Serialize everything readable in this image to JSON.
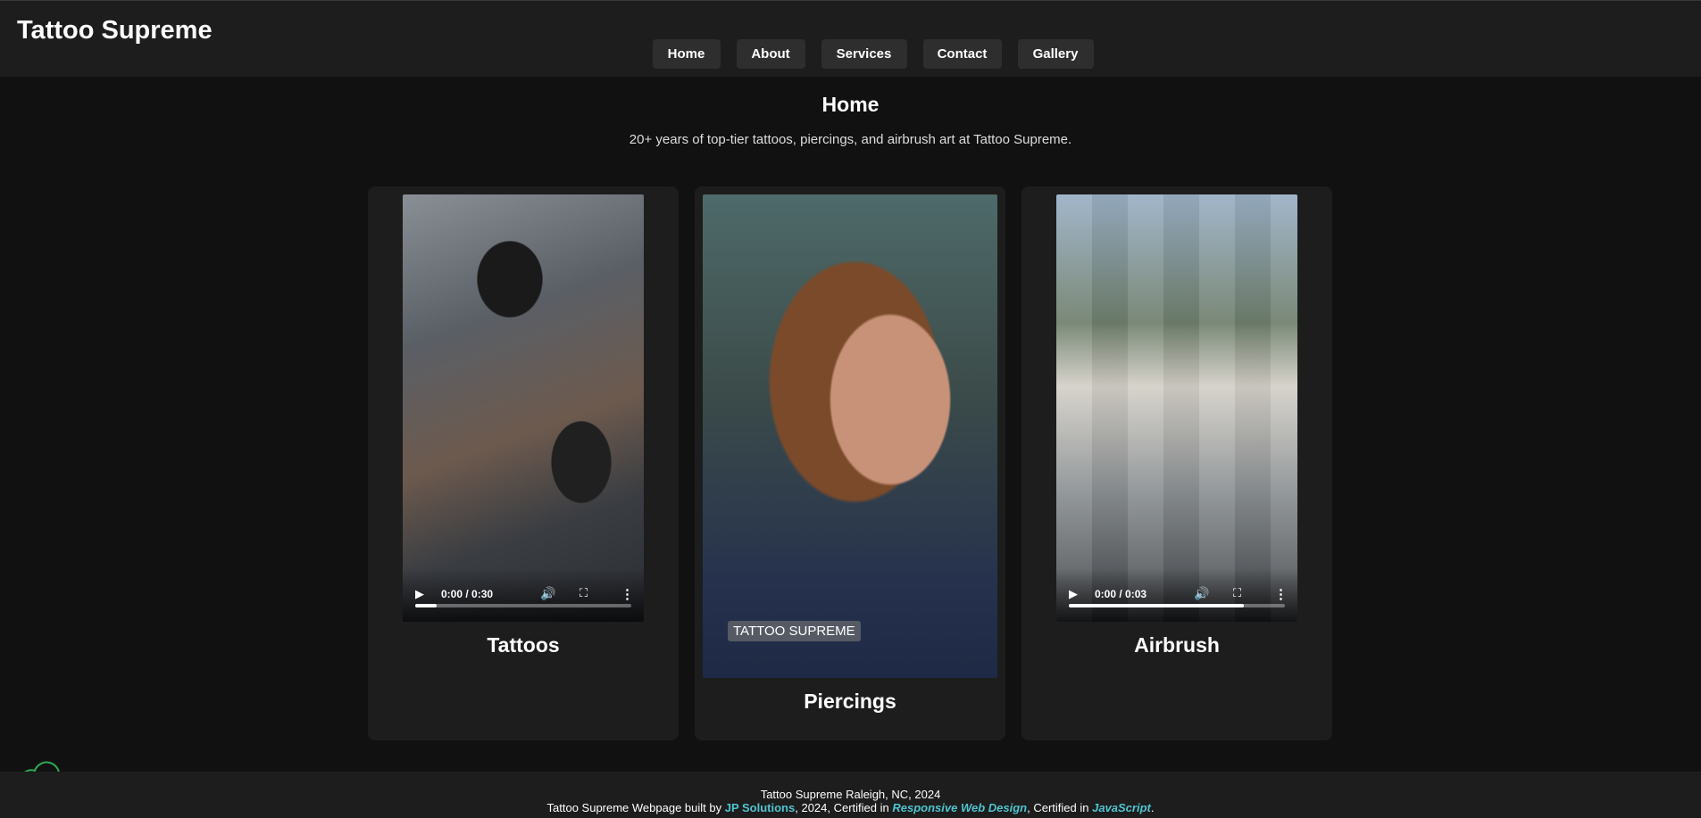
{
  "header": {
    "brand": "Tattoo Supreme",
    "nav": [
      "Home",
      "About",
      "Services",
      "Contact",
      "Gallery"
    ]
  },
  "main": {
    "title": "Home",
    "intro": "20+ years of top-tier tattoos, piercings, and airbrush art at Tattoo Supreme.",
    "cards": [
      {
        "label": "Tattoos",
        "time": "0:00 / 0:30",
        "progress": 0.1
      },
      {
        "label": "Piercings",
        "watermark": "TATTOO SUPREME"
      },
      {
        "label": "Airbrush",
        "time": "0:00 / 0:03",
        "progress": 0.81
      }
    ]
  },
  "footer": {
    "line1": "Tattoo Supreme Raleigh, NC, 2024",
    "prefix": "Tattoo Supreme Webpage built by ",
    "builder": "JP Solutions",
    "mid": ", 2024, Certified in ",
    "cert1": "Responsive Web Design",
    "mid2": ", Certified in ",
    "cert2": "JavaScript",
    "end": "."
  },
  "colors": {
    "link": "#4fc4cf",
    "cloud": "#2eaa55"
  },
  "icons": {
    "play": "play-icon",
    "volume": "volume-icon",
    "fullscreen": "fullscreen-icon",
    "more": "more-vertical-icon",
    "cloud": "cloud-icon"
  }
}
